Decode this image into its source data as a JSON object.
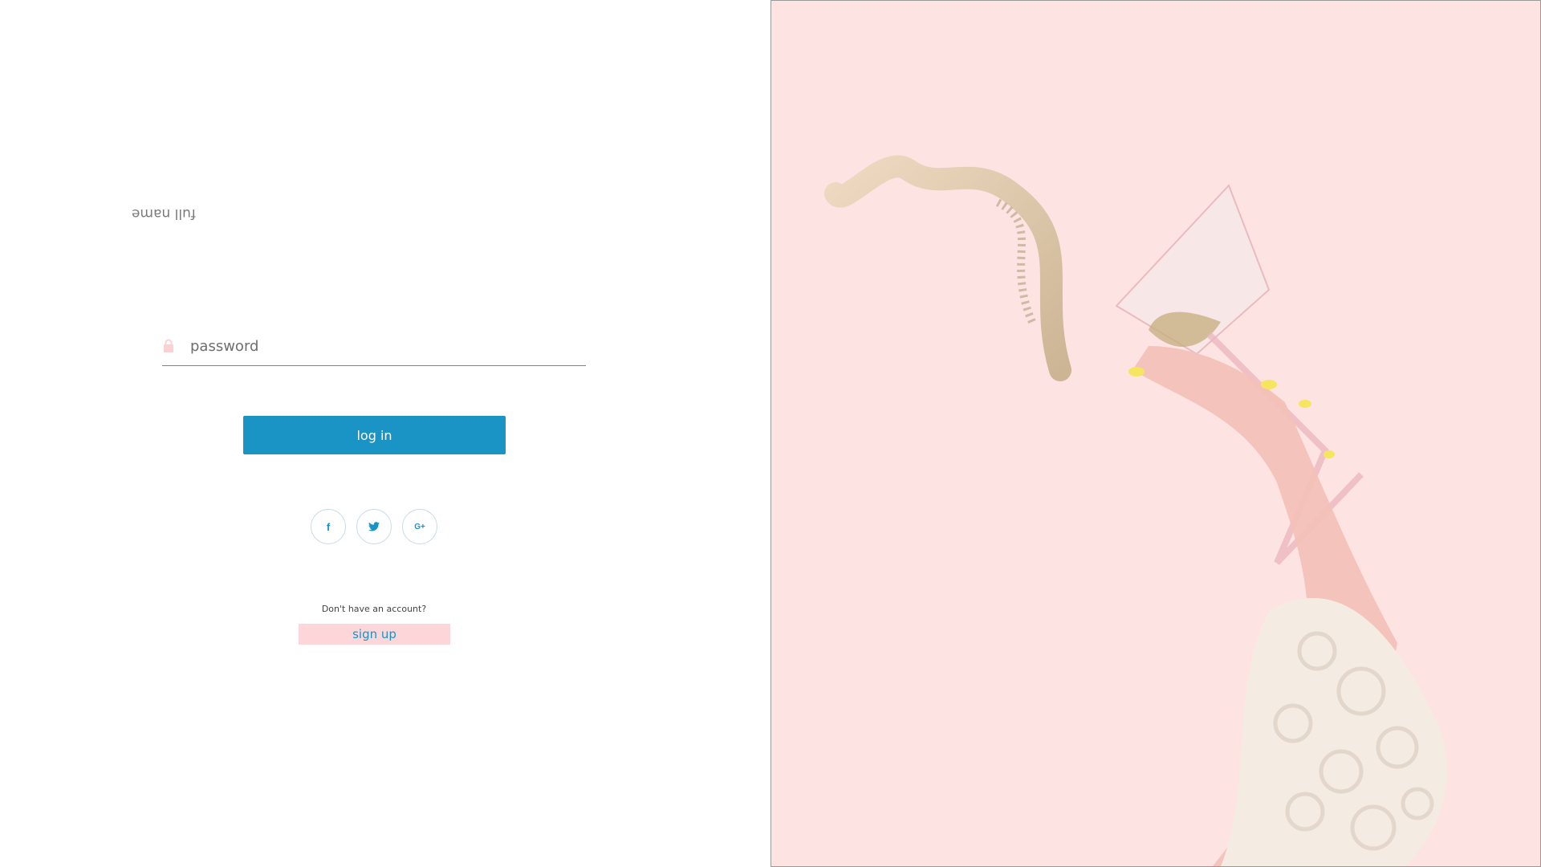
{
  "form": {
    "flipped_label": "full name",
    "password_placeholder": "password",
    "login_label": "log in",
    "no_account_text": "Don't have an account?",
    "signup_label": "sign up"
  },
  "social": [
    {
      "icon": "facebook-icon",
      "glyph": "f"
    },
    {
      "icon": "twitter-icon",
      "glyph": "🐦"
    },
    {
      "icon": "google-plus-icon",
      "glyph": "G+"
    }
  ],
  "colors": {
    "accent": "#1a94c4",
    "signup_bg": "#fdd6d9",
    "image_bg": "#fde4e3"
  },
  "image": {
    "subject": "hand holding tilted martini glass spilling gold glitter"
  }
}
